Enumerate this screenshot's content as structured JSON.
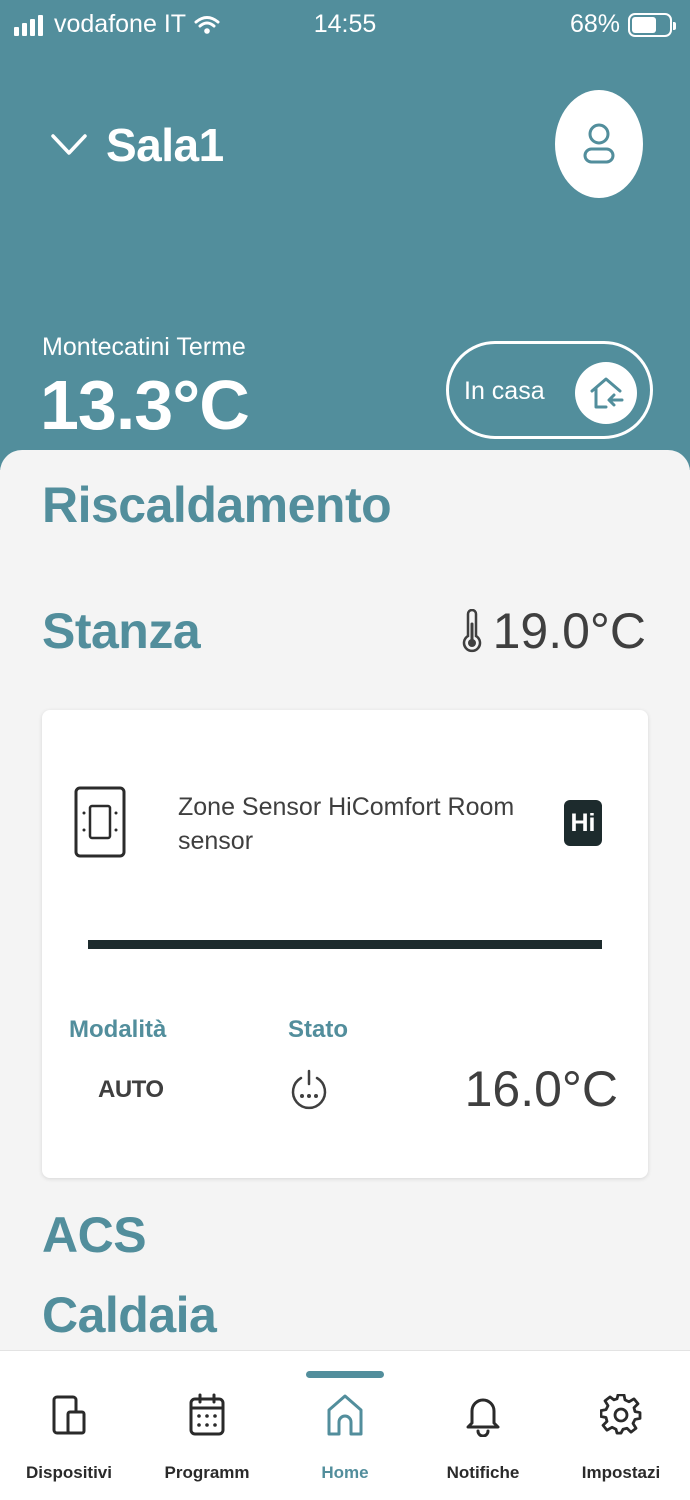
{
  "status_bar": {
    "carrier": "vodafone IT",
    "time": "14:55",
    "battery_percent": "68%",
    "battery_level": 0.68
  },
  "header": {
    "room_name": "Sala1",
    "location": "Montecatini Terme",
    "outdoor_temperature": "13.3°C",
    "presence_label": "In casa"
  },
  "main": {
    "heating_title": "Riscaldamento",
    "room_section_title": "Stanza",
    "room_temperature": "19.0°C",
    "device": {
      "name": "Zone Sensor HiComfort Room sensor",
      "brand_logo_text": "Hi",
      "mode_label": "Modalità",
      "mode_value": "AUTO",
      "state_label": "Stato",
      "setpoint": "16.0°C"
    },
    "acs_title": "ACS",
    "boiler_title": "Caldaia"
  },
  "tabbar": {
    "tabs": [
      {
        "label": "Dispositivi",
        "icon": "devices-icon"
      },
      {
        "label": "Programm",
        "icon": "calendar-icon"
      },
      {
        "label": "Home",
        "icon": "home-icon",
        "active": true
      },
      {
        "label": "Notifiche",
        "icon": "bell-icon"
      },
      {
        "label": "Impostazi",
        "icon": "gear-icon"
      }
    ]
  },
  "colors": {
    "accent": "#528e9c",
    "dark": "#1d2b2d",
    "background": "#f4f4f4",
    "text": "#3f3f3f"
  }
}
